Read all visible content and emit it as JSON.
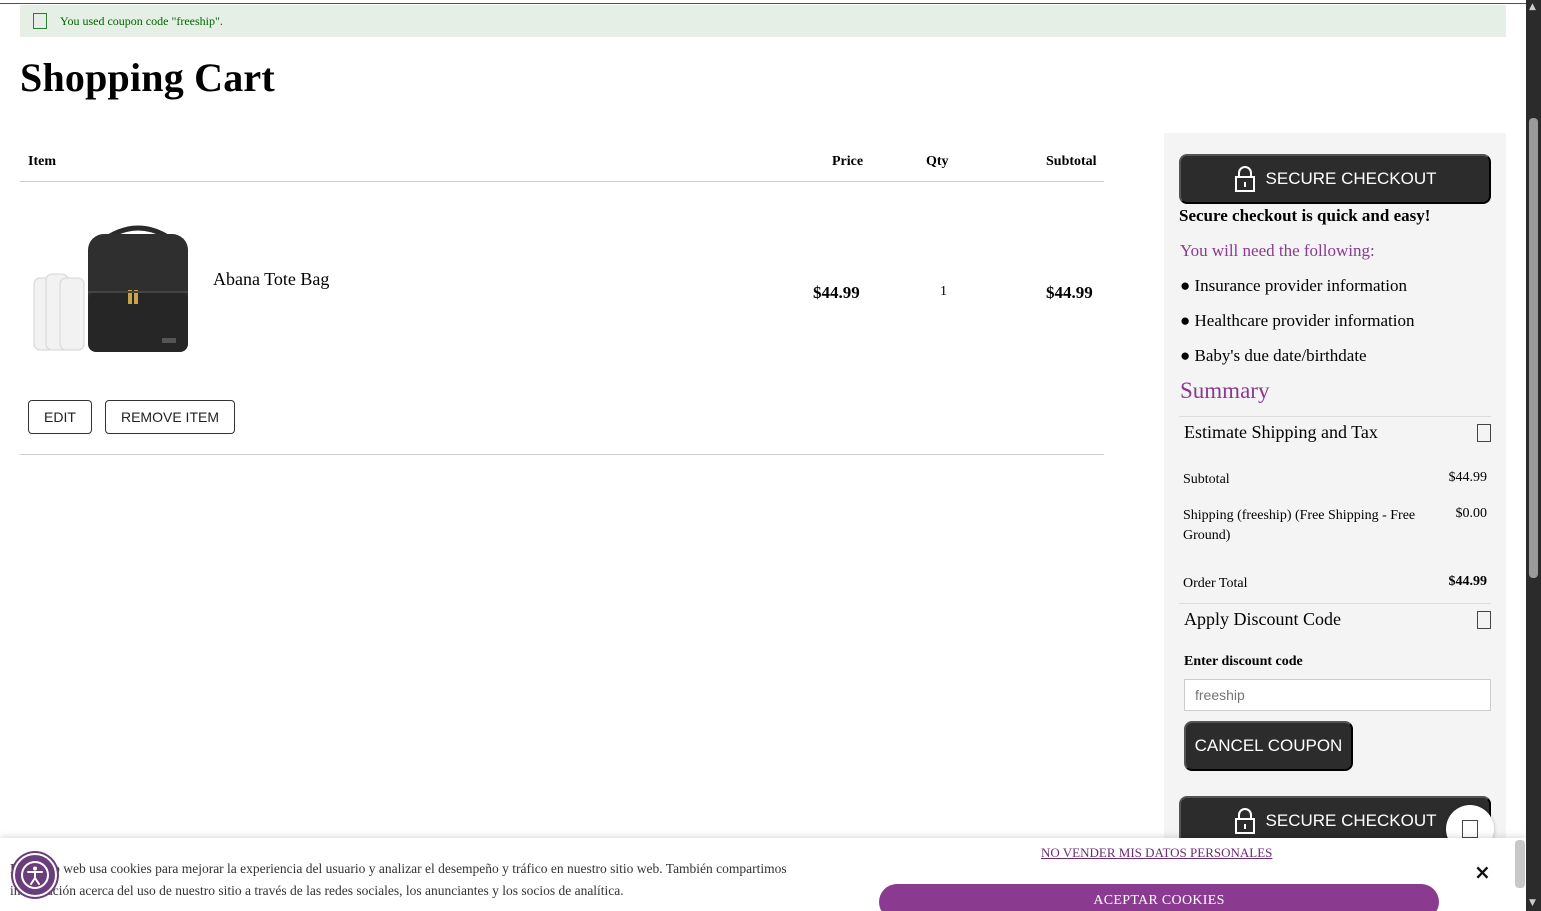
{
  "message": {
    "text": "You used coupon code \"freeship\"."
  },
  "page_title": "Shopping Cart",
  "cart": {
    "headers": {
      "item": "Item",
      "price": "Price",
      "qty": "Qty",
      "subtotal": "Subtotal"
    },
    "items": [
      {
        "name": "Abana Tote Bag",
        "price": "$44.99",
        "qty": "1",
        "subtotal": "$44.99"
      }
    ],
    "edit_label": "EDIT",
    "remove_label": "REMOVE ITEM"
  },
  "sidebar": {
    "secure_checkout_label": "SECURE CHECKOUT",
    "secure_quick": "Secure checkout is quick and easy!",
    "need_following": "You will need the following:",
    "requirements": [
      "● Insurance provider information",
      "● Healthcare provider information",
      "● Baby's due date/birthdate"
    ],
    "summary_title": "Summary",
    "estimate_label": "Estimate Shipping and Tax",
    "subtotal_label": "Subtotal",
    "subtotal_value": "$44.99",
    "shipping_label": "Shipping (freeship) (Free Shipping - Free Ground)",
    "shipping_value": "$0.00",
    "order_total_label": "Order Total",
    "order_total_value": "$44.99",
    "discount_label": "Apply Discount Code",
    "enter_discount_label": "Enter discount code",
    "discount_placeholder": "freeship",
    "cancel_coupon_label": "CANCEL COUPON"
  },
  "cookie": {
    "text": "Este sitio web usa cookies para mejorar la experiencia del usuario y analizar el desempeño y tráfico en nuestro sitio web. También compartimos información acerca del uso de nuestro sitio a través de las redes sociales, los anunciantes y los socios de analítica.",
    "no_sell_label": "NO VENDER MIS DATOS PERSONALES",
    "accept_label": "ACEPTAR COOKIES",
    "close_label": "×"
  },
  "colors": {
    "accent": "#8a3a8f",
    "dark_button": "#2c2c2c",
    "success_bg": "#e5efe5",
    "success_text": "#006400"
  }
}
